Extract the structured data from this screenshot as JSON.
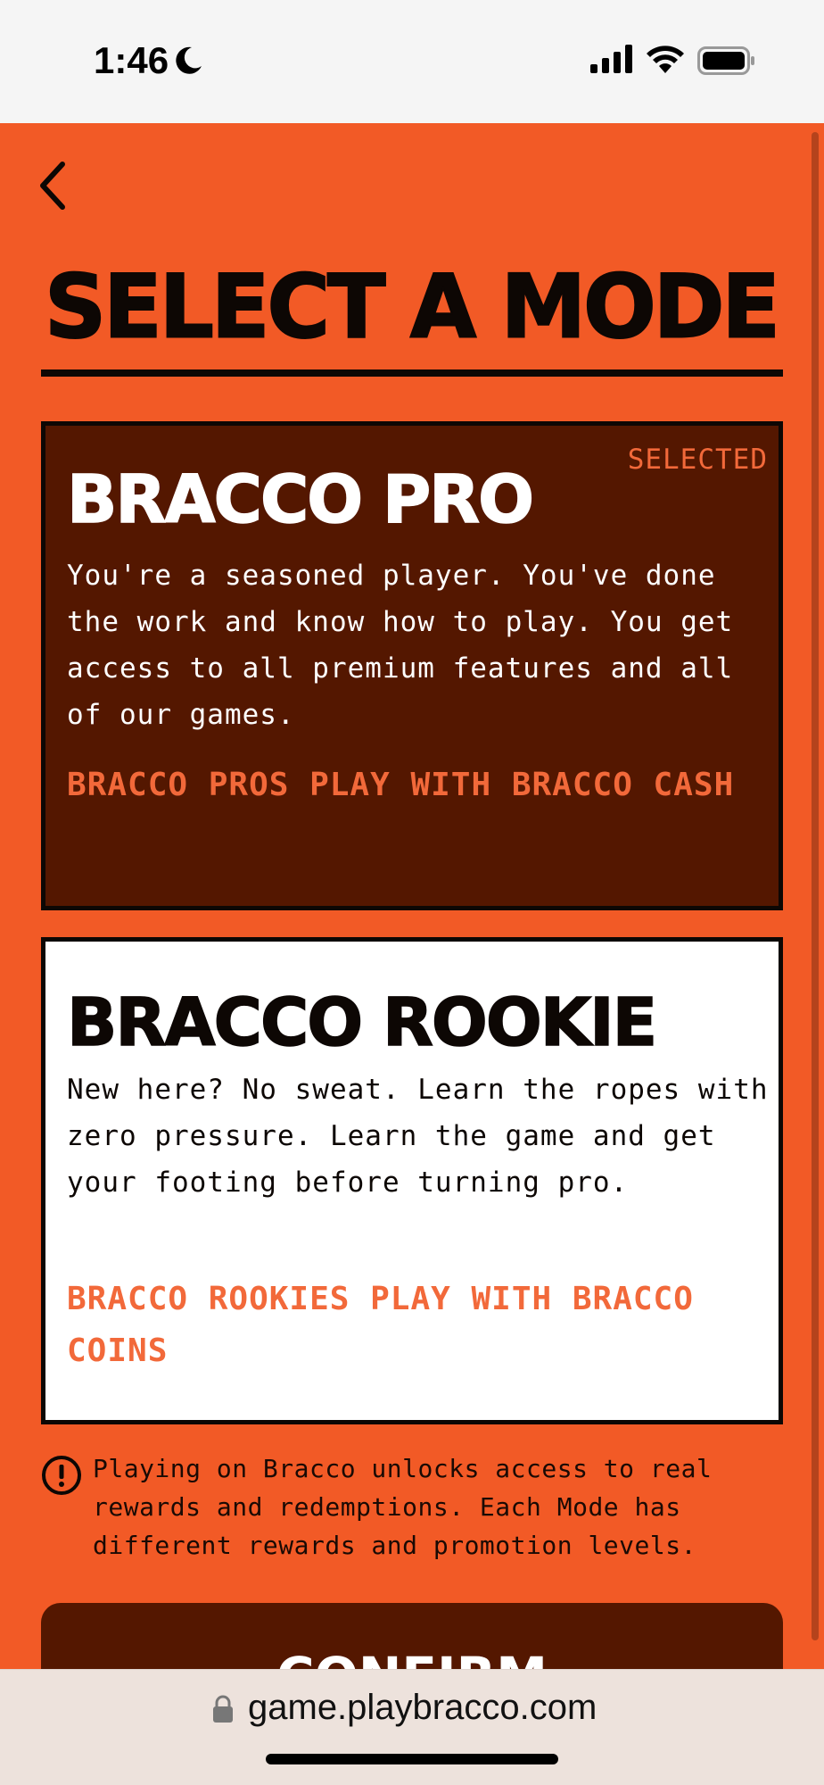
{
  "status": {
    "time": "1:46"
  },
  "page": {
    "title": "SELECT A MODE"
  },
  "modes": [
    {
      "name": "BRACCO PRO",
      "badge": "SELECTED",
      "description": "You're a seasoned player. You've done the work and know how to play. You get access to all premium features and all of our games.",
      "currency": "BRACCO PROS PLAY WITH BRACCO CASH"
    },
    {
      "name": "BRACCO ROOKIE",
      "description": "New here? No sweat. Learn the ropes with zero pressure. Learn the game and get your footing before turning pro.",
      "currency": "BRACCO ROOKIES PLAY WITH BRACCO COINS"
    }
  ],
  "info": {
    "text": "Playing on Bracco unlocks access to real rewards and redemptions. Each Mode has different rewards and promotion levels."
  },
  "confirm": {
    "label": "CONFIRM"
  },
  "browser": {
    "url": "game.playbracco.com"
  },
  "colors": {
    "accent": "#f25a26",
    "dark": "#541700",
    "highlight": "#f2693a"
  },
  "icons": [
    "moon-icon",
    "signal-icon",
    "wifi-icon",
    "battery-icon",
    "back-chevron-icon",
    "info-icon",
    "lock-icon"
  ]
}
